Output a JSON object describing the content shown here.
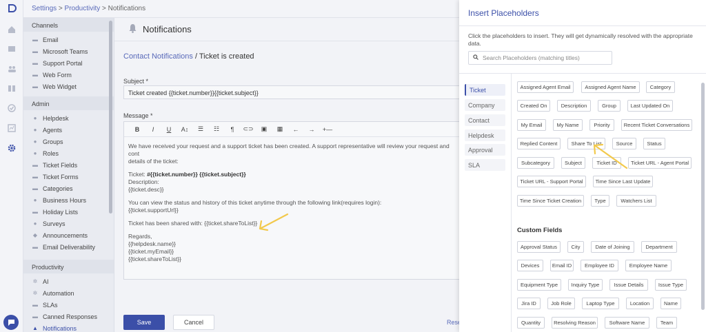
{
  "breadcrumb": {
    "settings": "Settings",
    "sep1": " > ",
    "productivity": "Productivity",
    "sep2": " > ",
    "current": "Notifications"
  },
  "sidebar": {
    "sections": [
      {
        "title": "Channels",
        "items": [
          "Email",
          "Microsoft Teams",
          "Support Portal",
          "Web Form",
          "Web Widget"
        ]
      },
      {
        "title": "Admin",
        "items": [
          "Helpdesk",
          "Agents",
          "Groups",
          "Roles",
          "Ticket Fields",
          "Ticket Forms",
          "Categories",
          "Business Hours",
          "Holiday Lists",
          "Surveys",
          "Announcements",
          "Email Deliverability"
        ]
      },
      {
        "title": "Productivity",
        "items": [
          "AI",
          "Automation",
          "SLAs",
          "Canned Responses",
          "Notifications"
        ]
      }
    ]
  },
  "page": {
    "title": "Notifications",
    "crumb_link": "Contact Notifications",
    "crumb_sep": " / ",
    "crumb_current": "Ticket is created",
    "subject_label": "Subject *",
    "subject_value": "Ticket created {{ticket.number}}{{ticket.subject}}",
    "message_label": "Message *",
    "message": {
      "p1": "We have received your request and a support ticket has been created. A support representative will review your request and cont",
      "p1b": "details of the ticket:",
      "ticket_prefix": "Ticket: ",
      "ticket_value": "#{{ticket.number}} {{ticket.subject}}",
      "description_label": "Description:",
      "description_value": "{{ticket.desc}}",
      "status_line": "You can view the status and history of this ticket anytime through the following link(requires login):",
      "status_link": "{{ticket.supportUrl}}",
      "shared_line": "Ticket has been shared with: {{ticket.shareToList}}",
      "regards": "Regards,",
      "sig1": "{{helpdesk.name}}",
      "sig2": "{{ticket.myEmail}}",
      "sig3": "{{ticket.shareToList}}"
    },
    "save_label": "Save",
    "cancel_label": "Cancel",
    "reset_label": "Rese"
  },
  "panel": {
    "title": "Insert Placeholders",
    "description": "Click the placeholders to insert. They will get dynamically resolved with the appropriate data.",
    "search_placeholder": "Search Placeholders (matching titles)",
    "categories": [
      "Ticket",
      "Company",
      "Contact",
      "Helpdesk",
      "Approval",
      "SLA"
    ],
    "active_category": "Ticket",
    "chips": [
      "Assigned Agent Email",
      "Assigned Agent Name",
      "Category",
      "Created On",
      "Description",
      "Group",
      "Last Updated On",
      "My Email",
      "My Name",
      "Priority",
      "Recent Ticket Conversations",
      "Replied Content",
      "Share To List",
      "Source",
      "Status",
      "Subcategory",
      "Subject",
      "Ticket ID",
      "Ticket URL - Agent Portal",
      "Ticket URL - Support Portal",
      "Time Since Last Update",
      "Time Since Ticket Creation",
      "Type",
      "Watchers List"
    ],
    "custom_fields_title": "Custom Fields",
    "custom_chips": [
      "Approval Status",
      "City",
      "Date of Joining",
      "Department",
      "Devices",
      "Email ID",
      "Employee ID",
      "Employee Name",
      "Equipment Type",
      "Inquiry Type",
      "Issue Details",
      "Issue Type",
      "Jira ID",
      "Job Role",
      "Laptop Type",
      "Location",
      "Name",
      "Quantity",
      "Resolving Reason",
      "Software Name",
      "Team"
    ]
  },
  "colors": {
    "accent": "#3b4fa8",
    "link": "#5869b9",
    "annotation_arrow": "#f2c94c"
  },
  "icons": [
    "logo-icon",
    "home-icon",
    "inbox-icon",
    "contacts-icon",
    "book-icon",
    "check-icon",
    "report-icon",
    "gear-icon",
    "chat-icon",
    "bell-icon",
    "search-icon"
  ]
}
